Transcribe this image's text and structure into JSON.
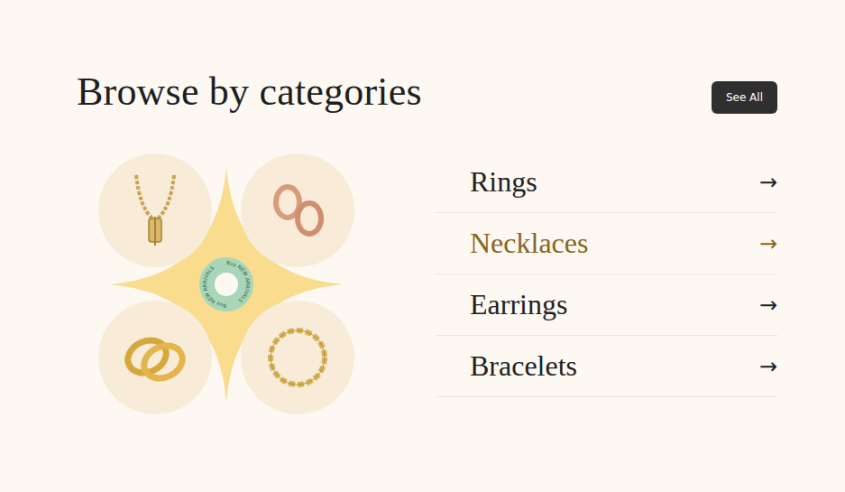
{
  "header": {
    "title": "Browse by categories",
    "see_all": "See All"
  },
  "badge": {
    "text": "Buy NEW ARRIVALS"
  },
  "categories": [
    {
      "label": "Rings",
      "arrow": "→",
      "selected": false
    },
    {
      "label": "Necklaces",
      "arrow": "→",
      "selected": true
    },
    {
      "label": "Earrings",
      "arrow": "→",
      "selected": false
    },
    {
      "label": "Bracelets",
      "arrow": "→",
      "selected": false
    }
  ]
}
